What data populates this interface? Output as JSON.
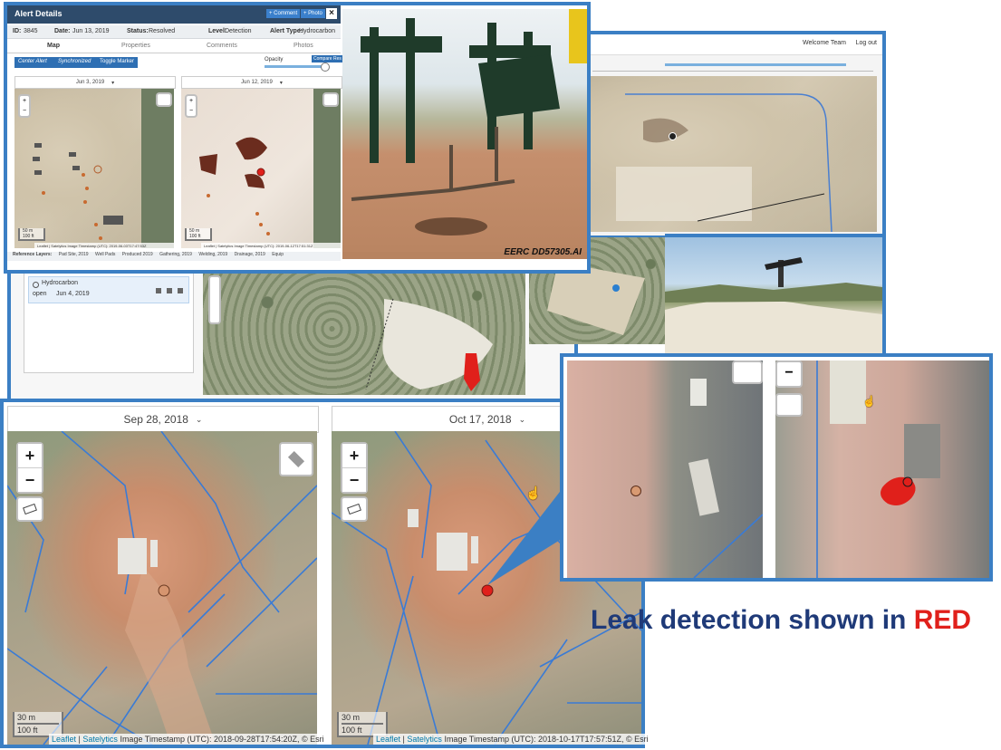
{
  "alert_panel": {
    "title": "Alert Details",
    "comment_btn": "+ Comment",
    "photo_btn": "+ Photo",
    "close_icon": "close-icon",
    "id_label": "ID:",
    "id_value": "3845",
    "date_label": "Date:",
    "date_value": "Jun 13, 2019",
    "status_label": "Status:",
    "status_value": "Resolved",
    "level_label": "Level:",
    "level_value": "Detection",
    "type_label": "Alert Type:",
    "type_value": "Hydrocarbon",
    "tabs": [
      "Map",
      "Properties",
      "Comments",
      "Photos"
    ],
    "center_alert": "Center Alert",
    "synchronized": "Synchronized",
    "toggle_marker": "Toggle Marker",
    "opacity_label": "Opacity",
    "compare_btn": "Compare Res",
    "map_left_date": "Jun 3, 2019",
    "map_right_date": "Jun 12, 2019",
    "attribution_left": "Leaflet | Satelytics Image Timestamp (UTC): 2019-06-03T17:47:53Z",
    "attribution_right": "Leaflet | Satelytics Image Timestamp (UTC): 2019-06-12T17:51:31Z",
    "scale_left_m": "50 m",
    "scale_left_ft": "100 ft",
    "scale_right_m": "50 m",
    "scale_right_ft": "100 ft",
    "ref_layers_label": "Reference Layers:",
    "ref_layers": [
      "Pad Site, 2019",
      "Well Pads",
      "Produced 2019",
      "Gathering, 2019",
      "Welding, 2019",
      "Drainage, 2019",
      "Equip"
    ]
  },
  "photo_caption": "EERC DD57305.AI",
  "back_panel": {
    "welcome": "Welcome Team",
    "log_out": "Log out",
    "list_item_type": "Hydrocarbon",
    "list_item_date": "Jun 4, 2019",
    "list_item_status": "open"
  },
  "bottom_maps": {
    "left_date": "Sep 28, 2018",
    "right_date": "Oct 17, 2018",
    "zoom_in": "+",
    "zoom_out": "−",
    "scale_m": "30 m",
    "scale_ft": "100 ft",
    "left_attr_leaflet": "Leaflet",
    "left_attr_sep": "|",
    "left_attr_sat": "Satelytics",
    "left_attr_rest": "Image Timestamp (UTC): 2018-09-28T17:54:20Z, © Esri",
    "right_attr_leaflet": "Leaflet",
    "right_attr_sep": "|",
    "right_attr_sat": "Satelytics",
    "right_attr_rest": "Image Timestamp (UTC): 2018-10-17T17:57:51Z, © Esri"
  },
  "caption": {
    "main": "Leak detection shown in ",
    "accent": "RED",
    "main_color": "#1f3a78",
    "accent_color": "#e0201b"
  },
  "colors": {
    "frame_blue": "#3b7fc4",
    "leak_red": "#e0201b",
    "pipeline_blue": "#3a7bd5"
  }
}
